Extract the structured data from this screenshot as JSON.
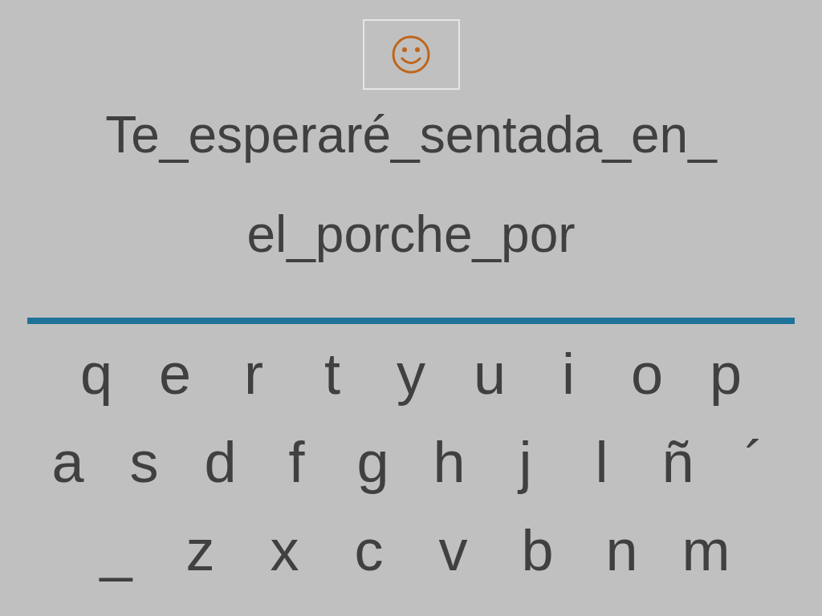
{
  "sentence_lines": [
    "Te_esperaré_sentada_en_",
    "el_porche_por"
  ],
  "keyboard": {
    "rows": [
      [
        "q",
        "e",
        "r",
        "t",
        "y",
        "u",
        "i",
        "o",
        "p"
      ],
      [
        "a",
        "s",
        "d",
        "f",
        "g",
        "h",
        "j",
        "l",
        "ñ",
        "´"
      ],
      [
        "_",
        "z",
        "x",
        "c",
        "v",
        "b",
        "n",
        "m"
      ]
    ]
  }
}
